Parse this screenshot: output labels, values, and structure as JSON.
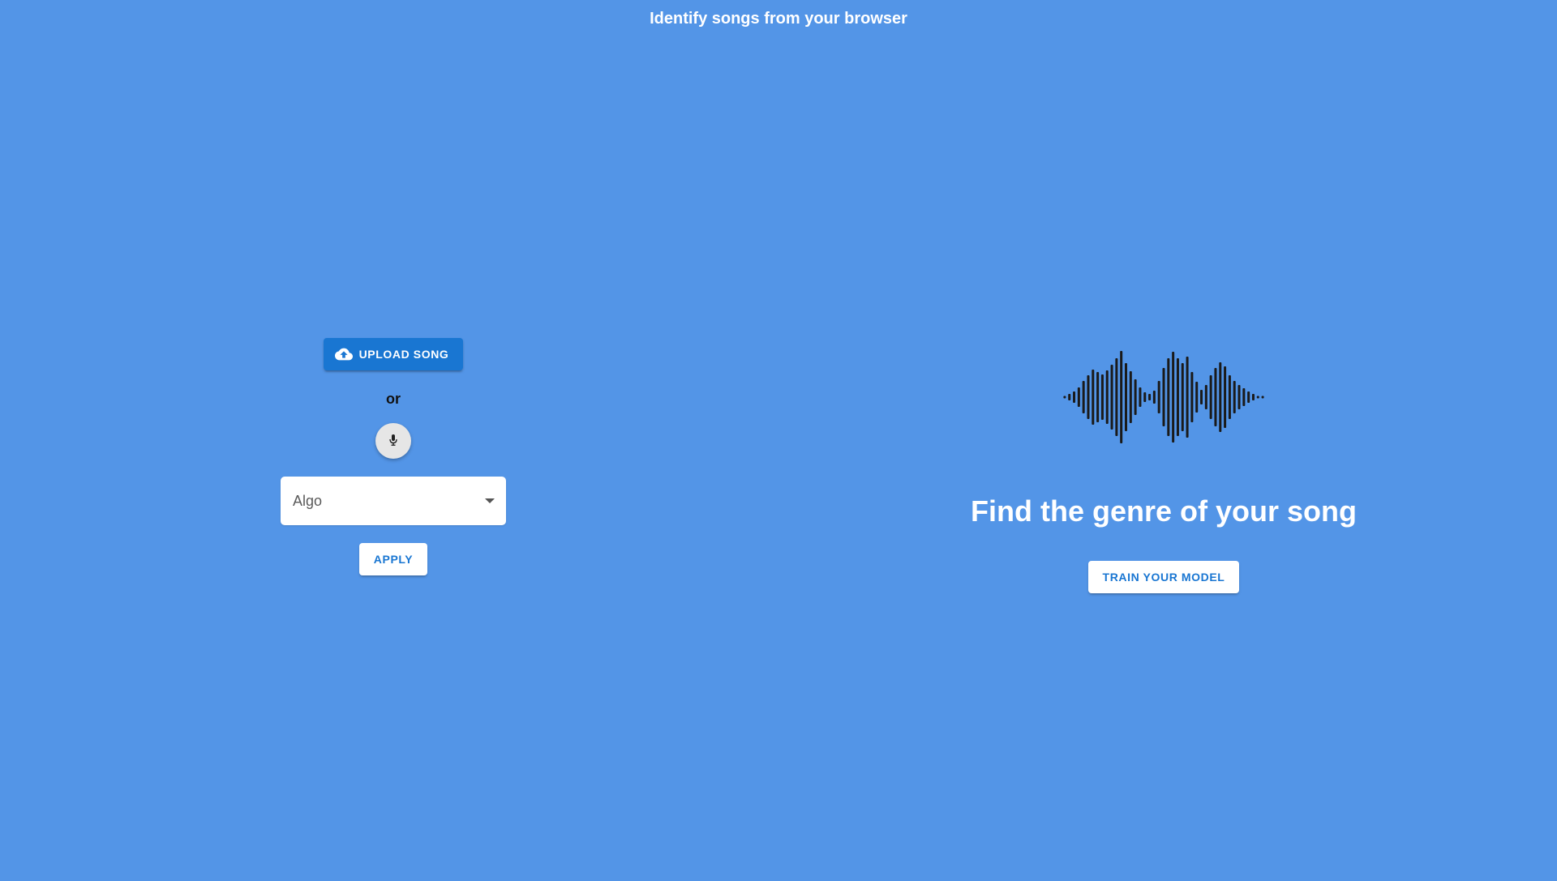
{
  "header": {
    "title": "Identify songs from your browser"
  },
  "left_panel": {
    "upload_button": {
      "label": "UPLOAD SONG",
      "icon": "cloud-upload-icon"
    },
    "or_text": "or",
    "mic_button": {
      "icon": "microphone-icon"
    },
    "algo_select": {
      "placeholder": "Algo",
      "icon": "chevron-down-icon"
    },
    "apply_button": {
      "label": "APPLY"
    }
  },
  "right_panel": {
    "waveform": {
      "icon": "sound-wave-icon",
      "color": "#1a1a1a"
    },
    "headline": "Find the genre of your song",
    "train_button": {
      "label": "TRAIN YOUR MODEL"
    }
  },
  "colors": {
    "background": "#5395E7",
    "primary_button": "#1976D2",
    "white": "#FFFFFF"
  }
}
